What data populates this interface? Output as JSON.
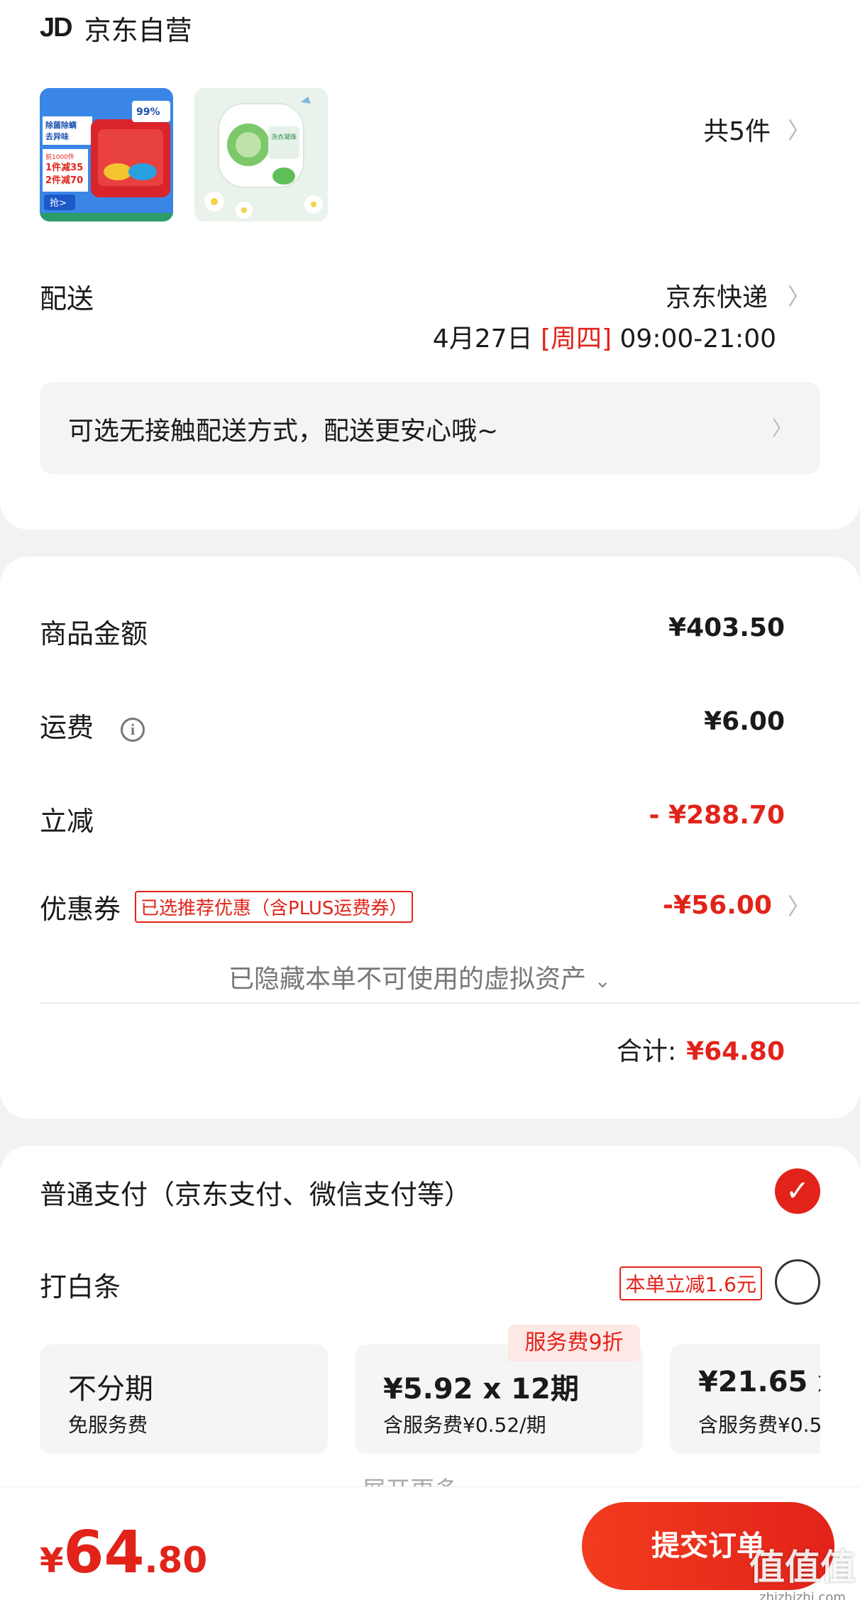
{
  "store": {
    "logo": "JD",
    "name": "京东自营"
  },
  "items": {
    "count_label": "共5件"
  },
  "thumb1": {
    "top_text": "除菌除螨\n去异味",
    "promo": "前1000件\n1件减35\n2件减70",
    "cta": "抢>"
  },
  "delivery": {
    "label": "配送",
    "method": "京东快递",
    "date": "4月27日",
    "weekday": "[周四]",
    "time": "09:00-21:00",
    "notice": "可选无接触配送方式，配送更安心哦~"
  },
  "summary": {
    "goods_label": "商品金额",
    "goods_value": "¥403.50",
    "shipping_label": "运费",
    "shipping_value": "¥6.00",
    "discount_label": "立减",
    "discount_value": "- ¥288.70",
    "coupon_label": "优惠券",
    "coupon_tag": "已选推荐优惠（含PLUS运费券）",
    "coupon_value": "-¥56.00",
    "hidden_note": "已隐藏本单不可使用的虚拟资产",
    "total_label": "合计:",
    "total_value": "¥64.80"
  },
  "payment": {
    "normal_label": "普通支付（京东支付、微信支付等）",
    "baitiao_label": "打白条",
    "baitiao_tag": "本单立减1.6元",
    "service_badge": "服务费9折",
    "plans": [
      {
        "title": "不分期",
        "sub": "免服务费"
      },
      {
        "title": "¥5.92 x 12期",
        "sub": "含服务费¥0.52/期"
      },
      {
        "title": "¥21.65 x",
        "sub": "含服务费¥0.5"
      }
    ],
    "peek_text": "展开更多"
  },
  "footer": {
    "price_symbol": "¥",
    "price_int": "64",
    "price_dec": ".80",
    "submit_label": "提交订单",
    "watermark": "值值值",
    "watermark_url": "zhizhizhi.com"
  },
  "colors": {
    "accent": "#e2231a",
    "background": "#f2f2f2",
    "card": "#ffffff"
  }
}
